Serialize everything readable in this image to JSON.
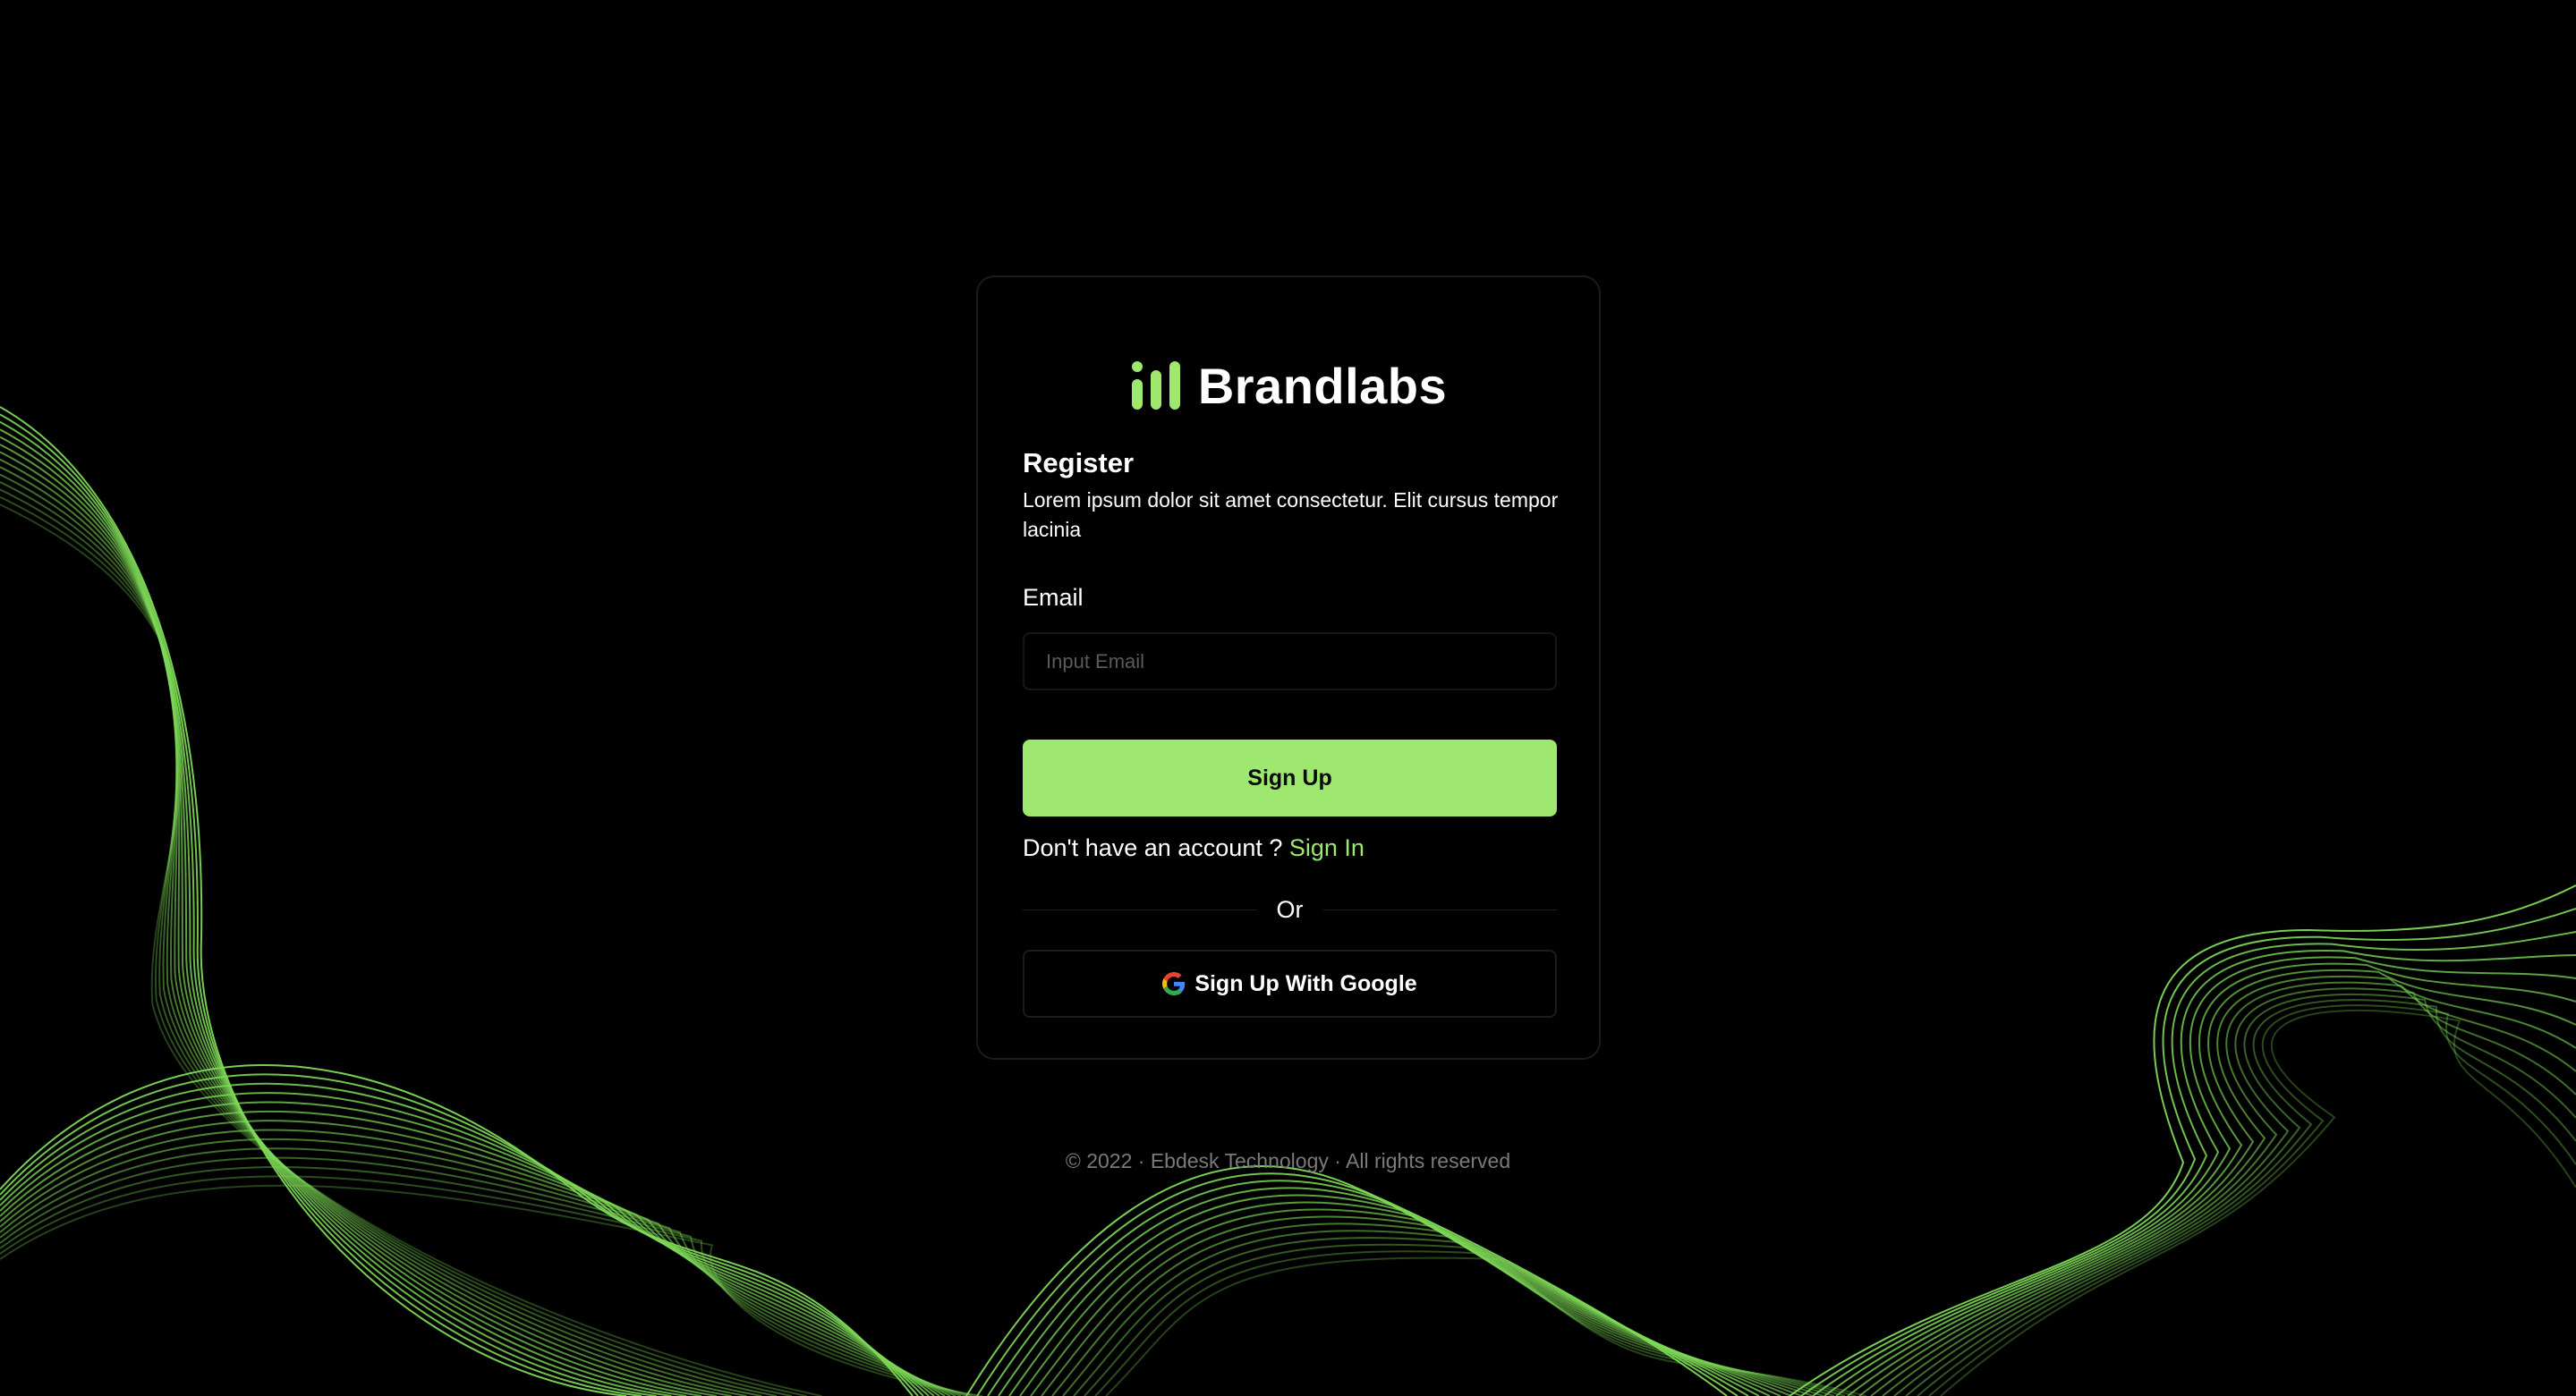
{
  "colors": {
    "background": "#000000",
    "accent": "#9fe870",
    "text": "#ffffff",
    "muted": "#7a7a7a"
  },
  "brand": {
    "name": "Brandlabs",
    "logo_icon": "bar-chart-icon"
  },
  "form": {
    "heading": "Register",
    "subtitle": "Lorem ipsum dolor sit amet consectetur. Elit cursus tempor lacinia",
    "email_label": "Email",
    "email_placeholder": "Input Email",
    "email_value": "",
    "signup_label": "Sign Up",
    "account_prompt": "Don't have an account ?",
    "signin_label": "Sign In",
    "divider_label": "Or",
    "google_label": "Sign Up With Google",
    "google_icon": "google-icon"
  },
  "footer": {
    "text": "© 2022 · Ebdesk Technology · All rights reserved"
  }
}
